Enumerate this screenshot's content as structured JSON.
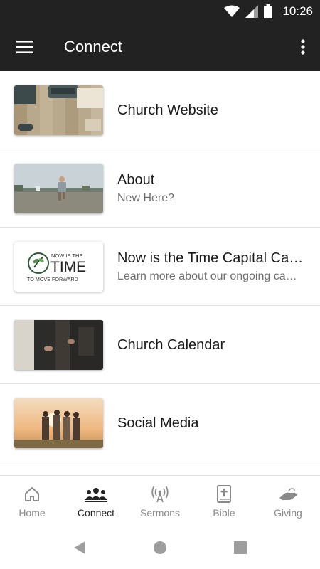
{
  "status_bar": {
    "time": "10:26"
  },
  "app_bar": {
    "title": "Connect"
  },
  "list": [
    {
      "title": "Church Website",
      "subtitle": "",
      "thumb": "typewriter-desk"
    },
    {
      "title": "About",
      "subtitle": "New Here?",
      "thumb": "child-running-field"
    },
    {
      "title": "Now is the Time Capital Campaign",
      "subtitle": "Learn more about our ongoing campaign",
      "thumb": "now-is-the-time-logo",
      "logo_text": {
        "top": "NOW IS THE",
        "main": "TIME",
        "bottom": "TO MOVE FORWARD"
      }
    },
    {
      "title": "Church Calendar",
      "subtitle": "",
      "thumb": "people-with-phones"
    },
    {
      "title": "Social Media",
      "subtitle": "",
      "thumb": "friends-at-sunset"
    }
  ],
  "bottom_nav": {
    "active": "Connect",
    "items": [
      {
        "label": "Home",
        "icon": "home-icon"
      },
      {
        "label": "Connect",
        "icon": "people-icon"
      },
      {
        "label": "Sermons",
        "icon": "broadcast-icon"
      },
      {
        "label": "Bible",
        "icon": "bible-icon"
      },
      {
        "label": "Giving",
        "icon": "giving-hand-icon"
      }
    ]
  },
  "colors": {
    "app_bar": "#222222",
    "active_nav": "#222222",
    "inactive_nav": "#8a8a8a"
  }
}
